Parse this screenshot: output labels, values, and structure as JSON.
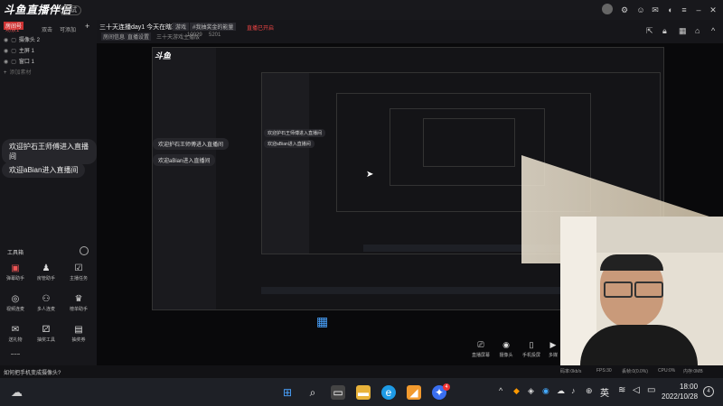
{
  "app": {
    "logo_text": "斗鱼直播伴侣",
    "version_badge": "测试"
  },
  "stream": {
    "title": "三十天连播day1 今天在瞎玩",
    "category_tag": "游戏",
    "tag2": "#我抽奖金的能量",
    "alert_text": "直播已开启",
    "room_id_label": "房间号",
    "room_id": "10029",
    "sub_link1": "房间信息",
    "sub_link2": "直播设置",
    "sub_info": "三十天游戏主播版",
    "followers": "10029",
    "fans": "5201"
  },
  "sidebar": {
    "tabs": [
      "场景1",
      "双击",
      "可添加"
    ],
    "sources": [
      {
        "label": "摄像头 2"
      },
      {
        "label": "主屏 1"
      },
      {
        "label": "窗口 1"
      },
      {
        "label": "添加素材"
      }
    ],
    "chat": [
      "欢迎护石王师傅进入直播间",
      "欢迎aBian进入直播间"
    ],
    "toolbox_label": "工具箱",
    "tools": [
      {
        "label": "弹幕助手",
        "icon": "danmu-icon"
      },
      {
        "label": "房管助手",
        "icon": "admin-icon"
      },
      {
        "label": "主播任务",
        "icon": "task-icon"
      },
      {
        "label": "视频连麦",
        "icon": "video-link-icon"
      },
      {
        "label": "多人连麦",
        "icon": "multi-link-icon"
      },
      {
        "label": "榜单助手",
        "icon": "rank-icon"
      },
      {
        "label": "送礼物",
        "icon": "gift-icon"
      },
      {
        "label": "抽奖工具",
        "icon": "lottery-icon"
      },
      {
        "label": "抽奖券",
        "icon": "ticket-icon"
      }
    ],
    "bottom_hint": "如何把手机变成摄像头?"
  },
  "bottom_controls": [
    {
      "label": "直播屏幕",
      "icon": "screen-icon"
    },
    {
      "label": "摄像头",
      "icon": "camera-icon"
    },
    {
      "label": "手机投屏",
      "icon": "phone-cast-icon"
    },
    {
      "label": "多媒",
      "icon": "media-icon"
    }
  ],
  "status_bar": {
    "items": [
      "码率:0kb/s",
      "FPS:30",
      "丢帧:0(0.0%)",
      "CPU:0%",
      "内存:0MB"
    ]
  },
  "taskbar": {
    "time": "18:00",
    "date": "2022/10/28",
    "lang": "英",
    "notif_count": "4"
  }
}
